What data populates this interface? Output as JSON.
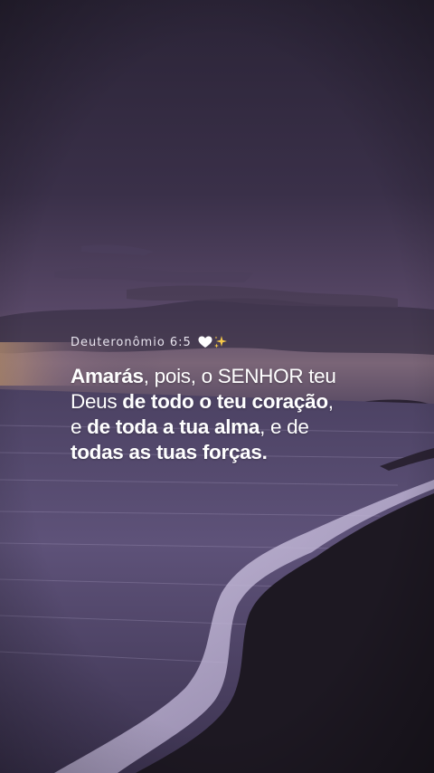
{
  "reference": {
    "text": "Deuteronômio 6:5"
  },
  "reference_icons": [
    "white-heart-icon",
    "sparkles-icon"
  ],
  "verse": {
    "lines": [
      [
        {
          "text": "Amarás",
          "bold": true
        },
        {
          "text": ", pois, o SENHOR teu",
          "bold": false
        }
      ],
      [
        {
          "text": "Deus ",
          "bold": false
        },
        {
          "text": "de todo o teu coração",
          "bold": true
        },
        {
          "text": ",",
          "bold": false
        }
      ],
      [
        {
          "text": "e ",
          "bold": false
        },
        {
          "text": "de toda a tua alma",
          "bold": true
        },
        {
          "text": ", e de",
          "bold": false
        }
      ],
      [
        {
          "text": "todas as tuas forças.",
          "bold": true
        }
      ]
    ]
  },
  "colors": {
    "sky_top": "#2b2437",
    "sky_mid": "#4a3d5f",
    "horizon_glow": "#8a6f6a",
    "sea": "#5a4d72",
    "foam": "#c9bfdc",
    "sand": "#1c1720",
    "text": "#ffffff"
  }
}
